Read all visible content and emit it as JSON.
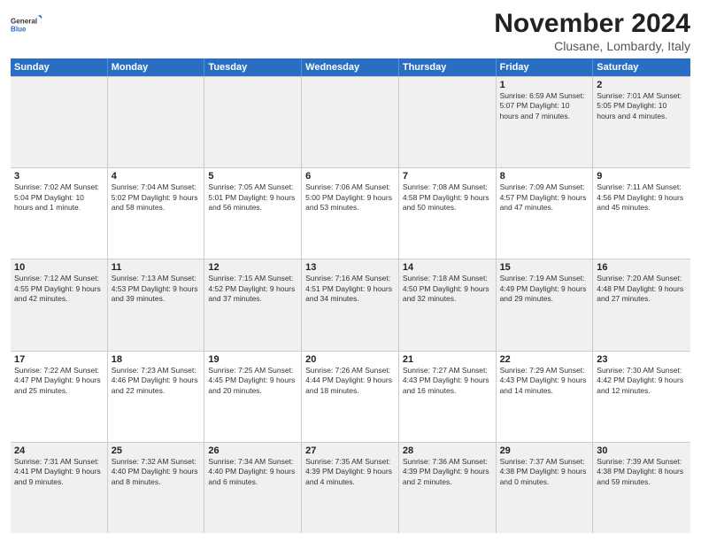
{
  "logo": {
    "general": "General",
    "blue": "Blue"
  },
  "header": {
    "month": "November 2024",
    "location": "Clusane, Lombardy, Italy"
  },
  "days": [
    "Sunday",
    "Monday",
    "Tuesday",
    "Wednesday",
    "Thursday",
    "Friday",
    "Saturday"
  ],
  "weeks": [
    [
      {
        "num": "",
        "info": ""
      },
      {
        "num": "",
        "info": ""
      },
      {
        "num": "",
        "info": ""
      },
      {
        "num": "",
        "info": ""
      },
      {
        "num": "",
        "info": ""
      },
      {
        "num": "1",
        "info": "Sunrise: 6:59 AM\nSunset: 5:07 PM\nDaylight: 10 hours and 7 minutes."
      },
      {
        "num": "2",
        "info": "Sunrise: 7:01 AM\nSunset: 5:05 PM\nDaylight: 10 hours and 4 minutes."
      }
    ],
    [
      {
        "num": "3",
        "info": "Sunrise: 7:02 AM\nSunset: 5:04 PM\nDaylight: 10 hours and 1 minute."
      },
      {
        "num": "4",
        "info": "Sunrise: 7:04 AM\nSunset: 5:02 PM\nDaylight: 9 hours and 58 minutes."
      },
      {
        "num": "5",
        "info": "Sunrise: 7:05 AM\nSunset: 5:01 PM\nDaylight: 9 hours and 56 minutes."
      },
      {
        "num": "6",
        "info": "Sunrise: 7:06 AM\nSunset: 5:00 PM\nDaylight: 9 hours and 53 minutes."
      },
      {
        "num": "7",
        "info": "Sunrise: 7:08 AM\nSunset: 4:58 PM\nDaylight: 9 hours and 50 minutes."
      },
      {
        "num": "8",
        "info": "Sunrise: 7:09 AM\nSunset: 4:57 PM\nDaylight: 9 hours and 47 minutes."
      },
      {
        "num": "9",
        "info": "Sunrise: 7:11 AM\nSunset: 4:56 PM\nDaylight: 9 hours and 45 minutes."
      }
    ],
    [
      {
        "num": "10",
        "info": "Sunrise: 7:12 AM\nSunset: 4:55 PM\nDaylight: 9 hours and 42 minutes."
      },
      {
        "num": "11",
        "info": "Sunrise: 7:13 AM\nSunset: 4:53 PM\nDaylight: 9 hours and 39 minutes."
      },
      {
        "num": "12",
        "info": "Sunrise: 7:15 AM\nSunset: 4:52 PM\nDaylight: 9 hours and 37 minutes."
      },
      {
        "num": "13",
        "info": "Sunrise: 7:16 AM\nSunset: 4:51 PM\nDaylight: 9 hours and 34 minutes."
      },
      {
        "num": "14",
        "info": "Sunrise: 7:18 AM\nSunset: 4:50 PM\nDaylight: 9 hours and 32 minutes."
      },
      {
        "num": "15",
        "info": "Sunrise: 7:19 AM\nSunset: 4:49 PM\nDaylight: 9 hours and 29 minutes."
      },
      {
        "num": "16",
        "info": "Sunrise: 7:20 AM\nSunset: 4:48 PM\nDaylight: 9 hours and 27 minutes."
      }
    ],
    [
      {
        "num": "17",
        "info": "Sunrise: 7:22 AM\nSunset: 4:47 PM\nDaylight: 9 hours and 25 minutes."
      },
      {
        "num": "18",
        "info": "Sunrise: 7:23 AM\nSunset: 4:46 PM\nDaylight: 9 hours and 22 minutes."
      },
      {
        "num": "19",
        "info": "Sunrise: 7:25 AM\nSunset: 4:45 PM\nDaylight: 9 hours and 20 minutes."
      },
      {
        "num": "20",
        "info": "Sunrise: 7:26 AM\nSunset: 4:44 PM\nDaylight: 9 hours and 18 minutes."
      },
      {
        "num": "21",
        "info": "Sunrise: 7:27 AM\nSunset: 4:43 PM\nDaylight: 9 hours and 16 minutes."
      },
      {
        "num": "22",
        "info": "Sunrise: 7:29 AM\nSunset: 4:43 PM\nDaylight: 9 hours and 14 minutes."
      },
      {
        "num": "23",
        "info": "Sunrise: 7:30 AM\nSunset: 4:42 PM\nDaylight: 9 hours and 12 minutes."
      }
    ],
    [
      {
        "num": "24",
        "info": "Sunrise: 7:31 AM\nSunset: 4:41 PM\nDaylight: 9 hours and 9 minutes."
      },
      {
        "num": "25",
        "info": "Sunrise: 7:32 AM\nSunset: 4:40 PM\nDaylight: 9 hours and 8 minutes."
      },
      {
        "num": "26",
        "info": "Sunrise: 7:34 AM\nSunset: 4:40 PM\nDaylight: 9 hours and 6 minutes."
      },
      {
        "num": "27",
        "info": "Sunrise: 7:35 AM\nSunset: 4:39 PM\nDaylight: 9 hours and 4 minutes."
      },
      {
        "num": "28",
        "info": "Sunrise: 7:36 AM\nSunset: 4:39 PM\nDaylight: 9 hours and 2 minutes."
      },
      {
        "num": "29",
        "info": "Sunrise: 7:37 AM\nSunset: 4:38 PM\nDaylight: 9 hours and 0 minutes."
      },
      {
        "num": "30",
        "info": "Sunrise: 7:39 AM\nSunset: 4:38 PM\nDaylight: 8 hours and 59 minutes."
      }
    ]
  ]
}
